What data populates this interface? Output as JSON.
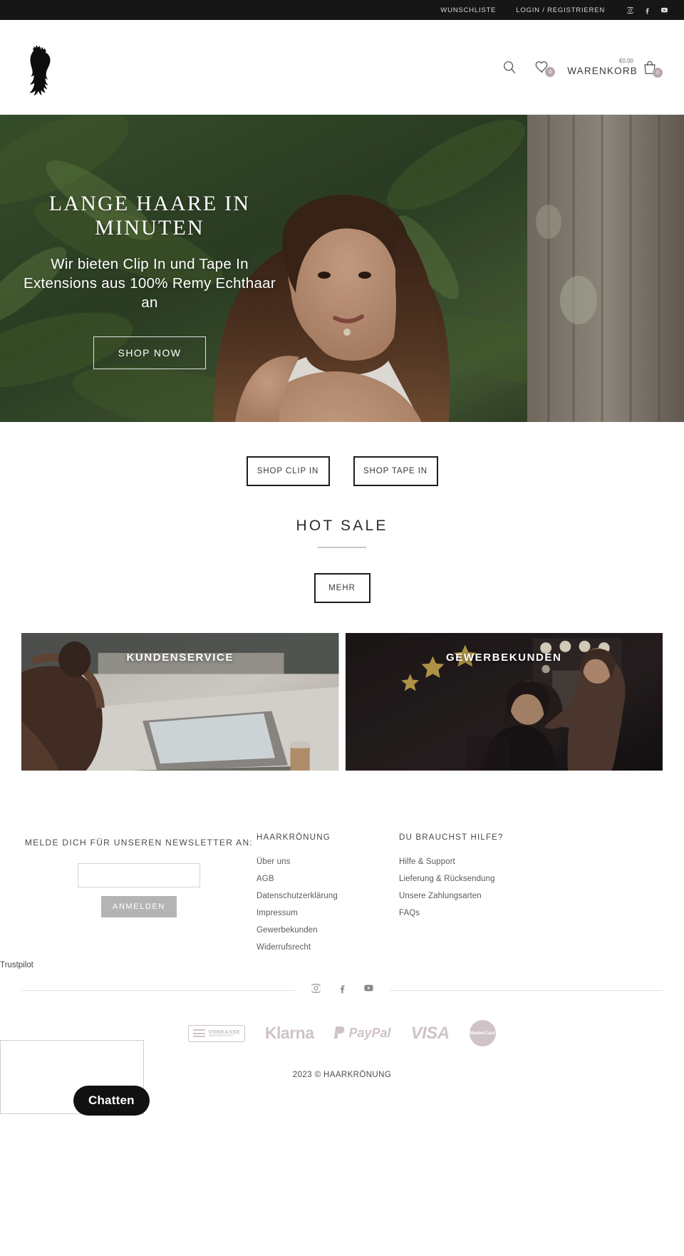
{
  "topbar": {
    "wishlist": "WUNSCHLISTE",
    "login": "LOGIN / REGISTRIEREN",
    "socials": [
      "instagram-icon",
      "facebook-icon",
      "youtube-icon"
    ]
  },
  "header": {
    "logo_alt": "HAARKRÖNUNG",
    "search_icon": "search-icon",
    "wishlist_icon": "heart-icon",
    "wishlist_count": "0",
    "cart_amount": "€0.00",
    "cart_label": "WARENKORB",
    "cart_icon": "shopping-bag-icon",
    "cart_count": "0"
  },
  "hero": {
    "title": "LANGE HAARE IN MINUTEN",
    "subtitle": "Wir bieten Clip In und Tape In Extensions aus 100% Remy Echthaar an",
    "cta": "SHOP NOW"
  },
  "shop_buttons": {
    "clip_in": "SHOP CLIP IN",
    "tape_in": "SHOP TAPE IN"
  },
  "hot_sale": {
    "title": "HOT SALE",
    "more": "MEHR"
  },
  "banners": [
    {
      "label": "KUNDENSERVICE"
    },
    {
      "label": "GEWERBEKUNDEN"
    }
  ],
  "newsletter": {
    "title": "MELDE DICH FÜR UNSEREN NEWSLETTER AN:",
    "input_value": "",
    "input_placeholder": "",
    "button": "ANMELDEN"
  },
  "footer_columns": [
    {
      "title": "HAARKRÖNUNG",
      "links": [
        "Über uns",
        "AGB",
        "Datenschutzerklärung",
        "Impressum",
        "Gewerbekunden",
        "Widerrufsrecht"
      ]
    },
    {
      "title": "DU BRAUCHST HILFE?",
      "links": [
        "Hilfe & Support",
        "Lieferung & Rücksendung",
        "Unsere Zahlungsarten",
        "FAQs"
      ]
    }
  ],
  "trustpilot": "Trustpilot",
  "footer_socials": [
    "instagram-icon",
    "facebook-icon",
    "youtube-icon"
  ],
  "payments": [
    {
      "name": "vorkasse",
      "label": "VORKASSE",
      "sublabel": "ÜBERWEISUNG"
    },
    {
      "name": "klarna",
      "label": "Klarna"
    },
    {
      "name": "paypal",
      "label": "PayPal"
    },
    {
      "name": "visa",
      "label": "VISA"
    },
    {
      "name": "mastercard",
      "label": "MasterCard"
    }
  ],
  "copyright": "2023 © HAARKRÖNUNG",
  "chat": {
    "button": "Chatten"
  },
  "colors": {
    "topbar_bg": "#161616",
    "badge": "#b9a7ad",
    "payment_tint": "#b2a0a8",
    "newsletter_btn": "#b4b4b4"
  }
}
